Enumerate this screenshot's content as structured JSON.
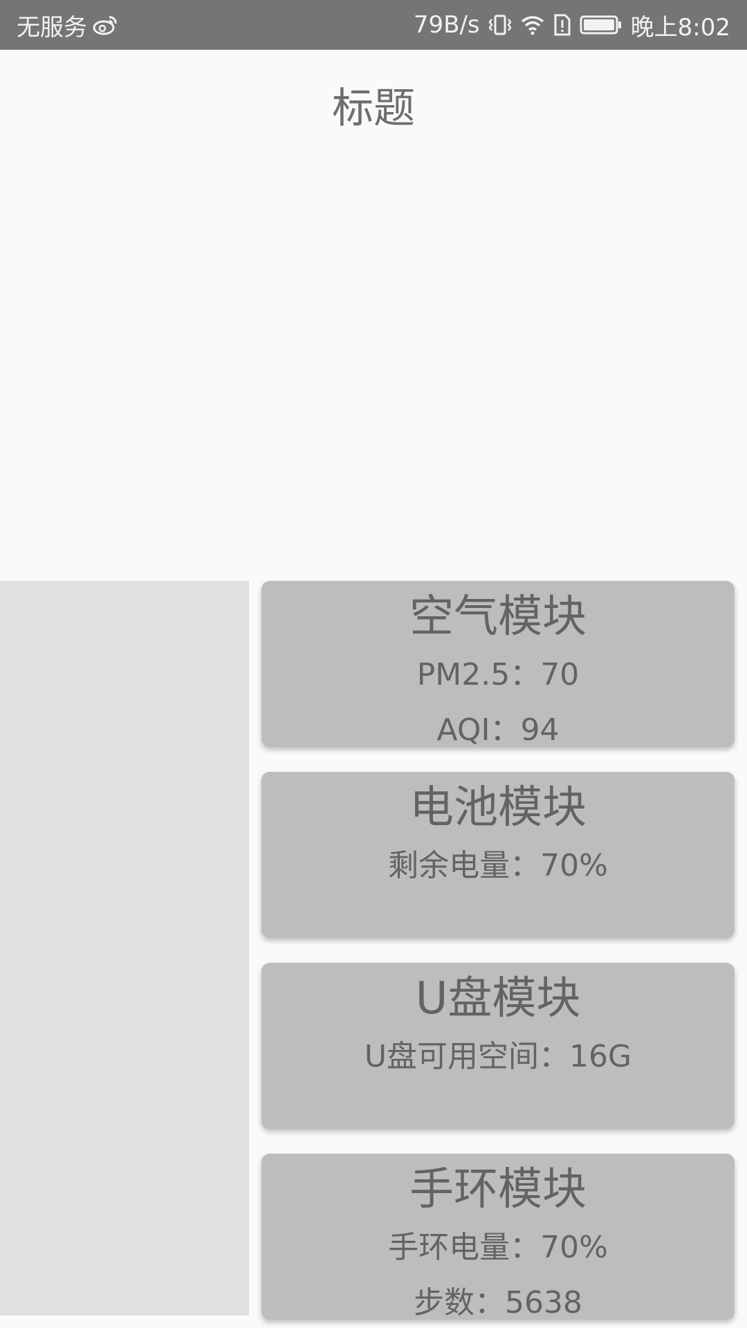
{
  "status_bar": {
    "carrier": "无服务",
    "network_speed": "79B/s",
    "time": "晚上8:02",
    "icons": [
      "weibo-icon",
      "vibrate-icon",
      "wifi-icon",
      "sim-alert-icon",
      "battery-icon"
    ]
  },
  "page": {
    "title": "标题"
  },
  "cards": [
    {
      "title": "空气模块",
      "lines": [
        "PM2.5：70",
        "AQI：94"
      ]
    },
    {
      "title": "电池模块",
      "lines": [
        "剩余电量：70%"
      ]
    },
    {
      "title": "U盘模块",
      "lines": [
        "U盘可用空间：16G"
      ]
    },
    {
      "title": "手环模块",
      "lines": [
        "手环电量：70%",
        "步数：5638"
      ]
    }
  ]
}
